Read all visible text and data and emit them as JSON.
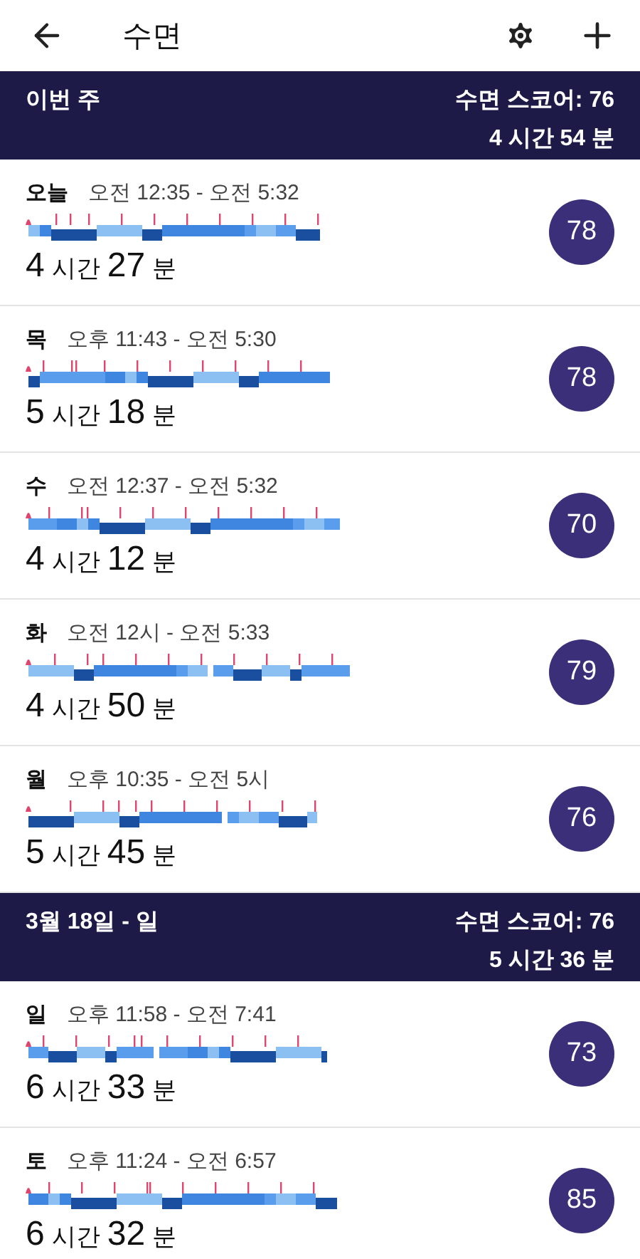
{
  "app_bar": {
    "title": "수면"
  },
  "sections": [
    {
      "title": "이번 주",
      "score": "수면 스코어: 76",
      "total": "4 시간 54 분",
      "nights": [
        {
          "day": "오늘",
          "time": "오전 12:35 - 오전 5:32",
          "duration": [
            "4",
            "시간",
            "27",
            "분"
          ],
          "score": "78"
        },
        {
          "day": "목",
          "time": "오후 11:43 - 오전 5:30",
          "duration": [
            "5",
            "시간",
            "18",
            "분"
          ],
          "score": "78"
        },
        {
          "day": "수",
          "time": "오전 12:37 - 오전 5:32",
          "duration": [
            "4",
            "시간",
            "12",
            "분"
          ],
          "score": "70"
        },
        {
          "day": "화",
          "time": "오전 12시 - 오전 5:33",
          "duration": [
            "4",
            "시간",
            "50",
            "분"
          ],
          "score": "79"
        },
        {
          "day": "월",
          "time": "오후 10:35 - 오전 5시",
          "duration": [
            "5",
            "시간",
            "45",
            "분"
          ],
          "score": "76"
        }
      ]
    },
    {
      "title": "3월 18일 - 일",
      "score": "수면 스코어: 76",
      "total": "5 시간 36 분",
      "nights": [
        {
          "day": "일",
          "time": "오후 11:58 - 오전 7:41",
          "duration": [
            "6",
            "시간",
            "33",
            "분"
          ],
          "score": "73"
        },
        {
          "day": "토",
          "time": "오후 11:24 - 오전 6:57",
          "duration": [
            "6",
            "시간",
            "32",
            "분"
          ],
          "score": "85"
        }
      ]
    }
  ]
}
